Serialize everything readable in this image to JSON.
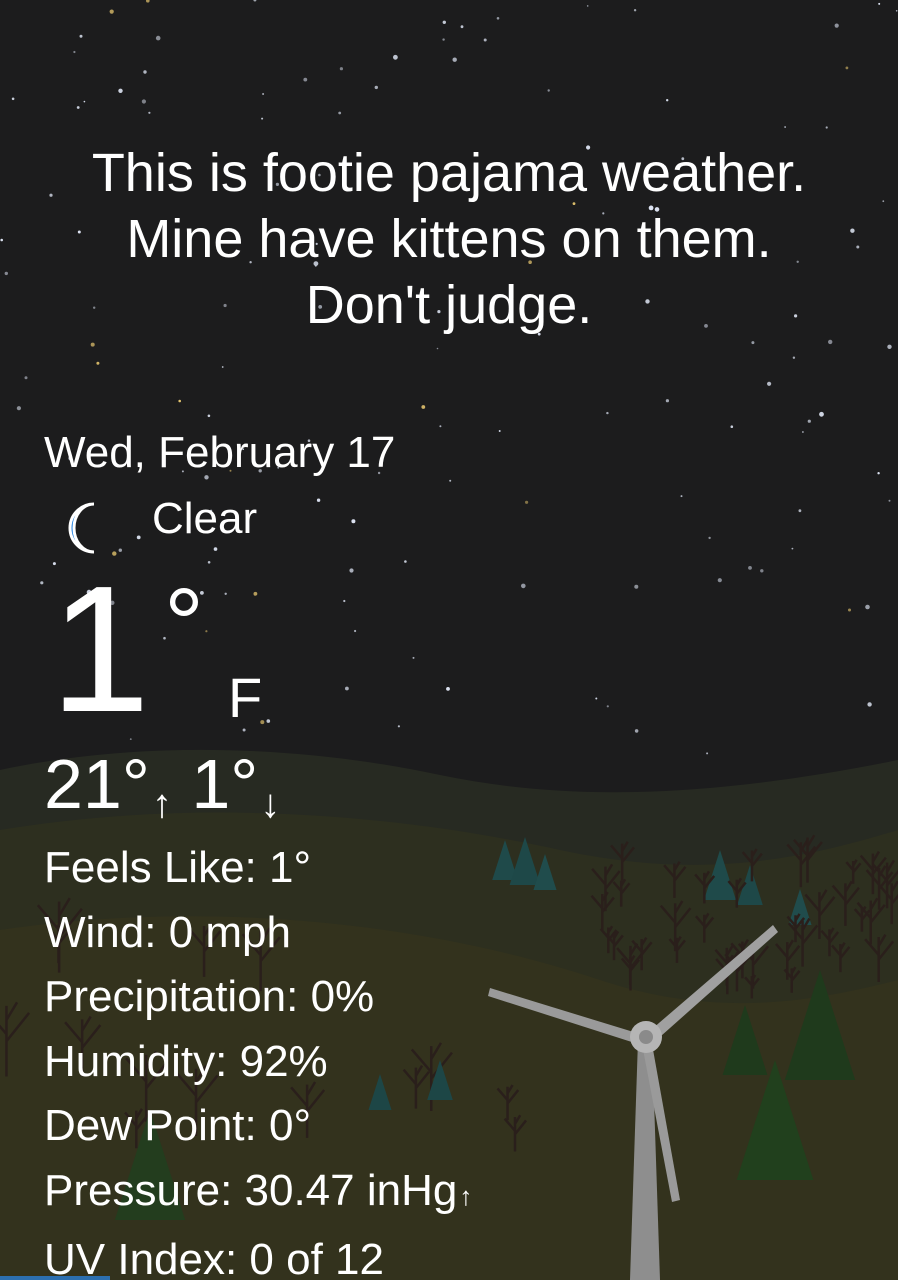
{
  "quote": {
    "lines": [
      "This is footie pajama weather.",
      "Mine have kittens on them.",
      "Don't judge."
    ]
  },
  "date": "Wed, February 17",
  "condition": {
    "icon": "moon-icon",
    "text": "Clear"
  },
  "current": {
    "temp": "1",
    "degree": "°",
    "unit": "F"
  },
  "hilo": {
    "high": "21°",
    "high_arrow": "↑",
    "low": "1°",
    "low_arrow": "↓"
  },
  "details": {
    "feels_like": "Feels Like: 1°",
    "wind": "Wind: 0 mph",
    "precipitation": "Precipitation: 0%",
    "humidity": "Humidity: 92%",
    "dew_point": "Dew Point: 0°",
    "pressure": "Pressure: 30.47 inHg",
    "pressure_trend": "↑",
    "uv_index": "UV Index: 0 of 12"
  },
  "colors": {
    "sky": "#1c1c1d",
    "hill_back": "#2a2d22",
    "hill_front": "#34331c",
    "moon": "#1f7fe0",
    "text": "#ffffff"
  }
}
